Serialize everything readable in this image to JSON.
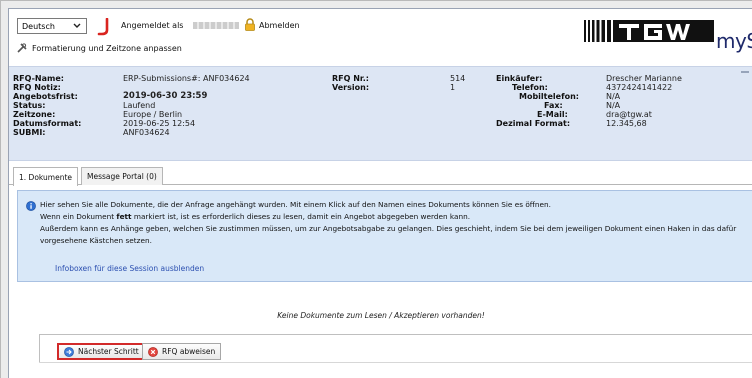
{
  "header": {
    "language": "Deutsch",
    "logged_in_label": "Angemeldet als",
    "logout_label": "Abmelden",
    "format_label": "Formatierung und Zeitzone anpassen",
    "logo_text": "mySRM"
  },
  "rfq": {
    "name_label": "RFQ-Name:",
    "name_value": "ERP-Submissions#: ANF034624",
    "note_label": "RFQ Notiz:",
    "note_value": "",
    "deadline_label": "Angebotsfrist:",
    "deadline_value": "2019-06-30 23:59",
    "status_label": "Status:",
    "status_value": "Laufend",
    "timezone_label": "Zeitzone:",
    "timezone_value": "Europe / Berlin",
    "dateformat_label": "Datumsformat:",
    "dateformat_value": "2019-06-25 12:54",
    "submi_label": "SUBMI:",
    "submi_value": "ANF034624",
    "nr_label": "RFQ Nr.:",
    "nr_value": "514",
    "version_label": "Version:",
    "version_value": "1",
    "buyer_label": "Einkäufer:",
    "buyer_value": "Drescher Marianne",
    "phone_label": "Telefon:",
    "phone_value": "4372424141422",
    "mobile_label": "Mobiltelefon:",
    "mobile_value": "N/A",
    "fax_label": "Fax:",
    "fax_value": "N/A",
    "email_label": "E-Mail:",
    "email_value": "dra@tgw.at",
    "decimal_label": "Dezimal Format:",
    "decimal_value": "12.345,68"
  },
  "tabs": [
    {
      "label": "1. Dokumente"
    },
    {
      "label": "Message Portal (0)"
    }
  ],
  "infobox": {
    "line1": "Hier sehen Sie alle Dokumente, die der Anfrage angehängt wurden. Mit einem Klick auf den Namen eines Dokuments können Sie es öffnen.",
    "line2_pre": "Wenn ein Dokument ",
    "line2_bold": "fett",
    "line2_post": " markiert ist, ist es erforderlich dieses zu lesen, damit ein Angebot abgegeben werden kann.",
    "line3": "Außerdem kann es Anhänge geben, welchen Sie zustimmen müssen, um zur Angebotsabgabe zu gelangen. Dies geschieht, indem Sie bei dem jeweiligen Dokument einen Haken in das dafür",
    "line4": "vorgesehene Kästchen setzen.",
    "hide_link": "Infoboxen für diese Session ausblenden"
  },
  "empty_message": "Keine Dokumente zum Lesen / Akzeptieren vorhanden!",
  "buttons": {
    "next": "Nächster Schritt",
    "reject": "RFQ abweisen"
  },
  "colors": {
    "panel_bg": "#dde6f4",
    "infobox_bg": "#d9e8f8",
    "link": "#2b4fb0",
    "highlight": "#d22a2a"
  }
}
